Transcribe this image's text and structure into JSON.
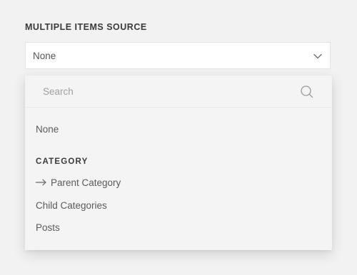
{
  "field": {
    "label": "MULTIPLE ITEMS SOURCE",
    "selected_value": "None"
  },
  "dropdown": {
    "search_placeholder": "Search",
    "none_option": "None",
    "group_heading": "CATEGORY",
    "options": [
      {
        "label": "Parent Category",
        "icon": "arrow-right-icon"
      },
      {
        "label": "Child Categories"
      },
      {
        "label": "Posts"
      }
    ]
  },
  "colors": {
    "background": "#f2f2f2",
    "dropdown_bg": "#f4f4f4",
    "input_bg": "#ffffff",
    "text": "#555555",
    "placeholder": "#a0a0a0"
  }
}
